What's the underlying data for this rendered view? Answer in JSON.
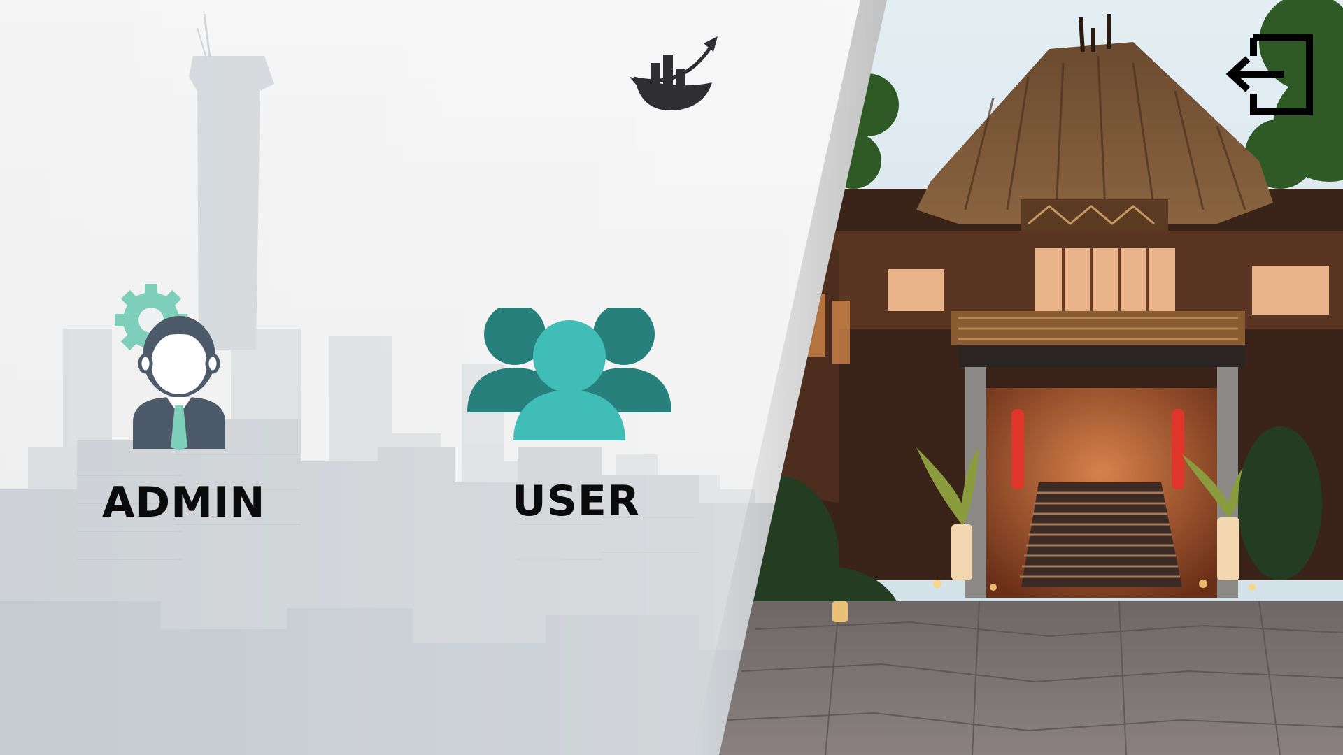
{
  "screen": {
    "name": "role-selection"
  },
  "brand": {
    "logo_icon": "growth-chart-logo-icon",
    "logo_color": "#2f2f33"
  },
  "roles": [
    {
      "id": "admin",
      "label": "ADMIN",
      "icon": "admin-user-gear-icon",
      "icon_colors": {
        "gear": "#7dcfba",
        "body": "#4d5a69",
        "tie": "#7dcfba"
      }
    },
    {
      "id": "user",
      "label": "USER",
      "icon": "user-group-icon",
      "icon_colors": {
        "back": "#27807c",
        "front": "#3fbdb6"
      }
    }
  ],
  "toolbar": {
    "logout_icon": "logout-arrow-icon",
    "logout_color": "#000000"
  },
  "backgrounds": {
    "left": "faded-city-skyline",
    "right": "tropical-resort-entrance-at-dusk"
  }
}
